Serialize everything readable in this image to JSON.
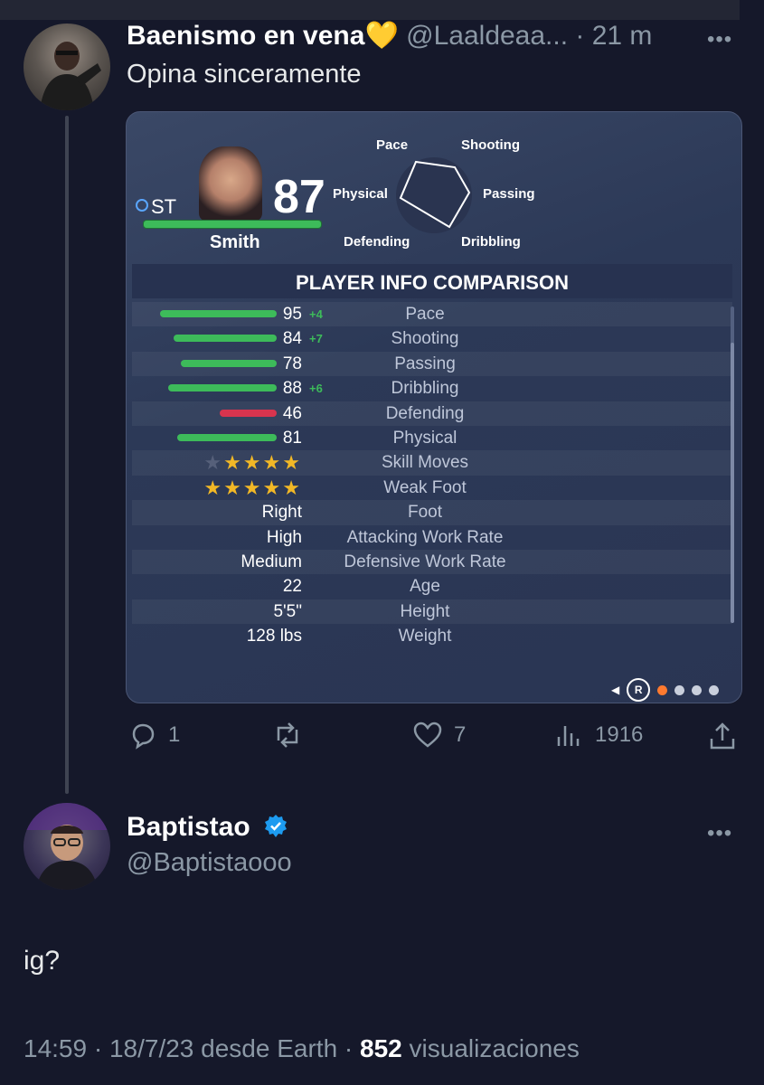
{
  "tweet": {
    "author_name": "Baenismo en vena",
    "author_emoji": "💛",
    "handle_time": "@Laaldeaa... · 21 m",
    "text": "Opina sinceramente",
    "more": "•••"
  },
  "card": {
    "position": "ST",
    "overall": "87",
    "player_name": "Smith",
    "hex_labels": {
      "pace": "Pace",
      "shooting": "Shooting",
      "physical": "Physical",
      "passing": "Passing",
      "defending": "Defending",
      "dribbling": "Dribbling"
    },
    "section_title": "PLAYER INFO COMPARISON",
    "stat_rows": [
      {
        "value": "95",
        "bonus": "+4",
        "label": "Pace",
        "bar_level": 95,
        "bar_color": "#3dbb5a"
      },
      {
        "value": "84",
        "bonus": "+7",
        "label": "Shooting",
        "bar_level": 84,
        "bar_color": "#3dbb5a"
      },
      {
        "value": "78",
        "bonus": "",
        "label": "Passing",
        "bar_level": 78,
        "bar_color": "#3dbb5a"
      },
      {
        "value": "88",
        "bonus": "+6",
        "label": "Dribbling",
        "bar_level": 88,
        "bar_color": "#3dbb5a"
      },
      {
        "value": "46",
        "bonus": "",
        "label": "Defending",
        "bar_level": 46,
        "bar_color": "#d8344e"
      },
      {
        "value": "81",
        "bonus": "",
        "label": "Physical",
        "bar_level": 81,
        "bar_color": "#3dbb5a"
      }
    ],
    "star_rows": [
      {
        "label": "Skill Moves",
        "stars": 4,
        "max": 5
      },
      {
        "label": "Weak Foot",
        "stars": 5,
        "max": 5
      }
    ],
    "info_rows": [
      {
        "value": "Right",
        "label": "Foot"
      },
      {
        "value": "High",
        "label": "Attacking Work Rate"
      },
      {
        "value": "Medium",
        "label": "Defensive Work Rate"
      },
      {
        "value": "22",
        "label": "Age"
      },
      {
        "value": "5'5\"",
        "label": "Height"
      },
      {
        "value": "128 lbs",
        "label": "Weight"
      }
    ],
    "pager_button": "R",
    "pager_active_index": 0,
    "pager_count": 4
  },
  "actions": {
    "replies": "1",
    "retweets": "",
    "likes": "7",
    "views": "1916"
  },
  "reply": {
    "author_name": "Baptistao",
    "handle": "@Baptistaooo",
    "verified": true,
    "text": "ig?",
    "more": "•••",
    "time": "14:59 · 18/7/23 desde Earth · ",
    "views_count": "852",
    "views_label": " visualizaciones"
  },
  "colors": {
    "background": "#15182a",
    "verified_badge": "#1d9bf0",
    "stat_bar_green": "#3dbb5a",
    "stat_bar_red": "#d8344e",
    "star": "#f2b826",
    "pager_active": "#ff7a2f"
  }
}
